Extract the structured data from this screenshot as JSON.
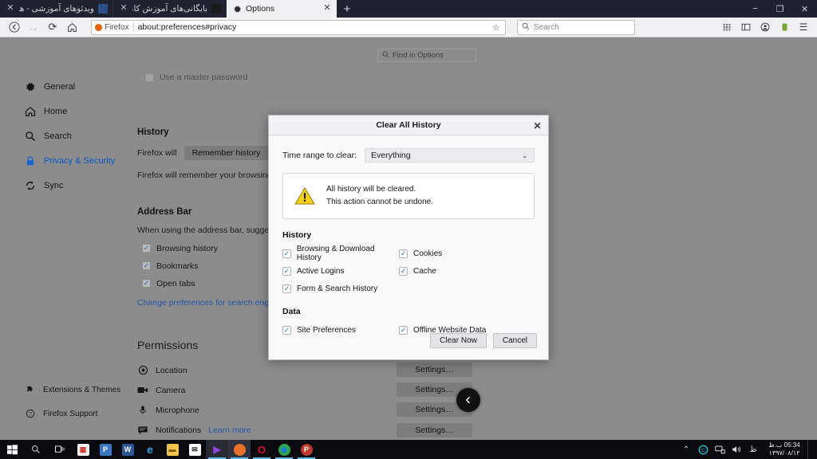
{
  "browser": {
    "tabs": [
      {
        "title": "ویدئوهای آموزشی - هوشیار",
        "favicon": "video-site-favicon",
        "active": false,
        "close_label": "✕"
      },
      {
        "title": "بایگانی‌های آموزش کامپیوتر - هو",
        "favicon": "archive-site-favicon",
        "active": false,
        "close_label": "✕"
      },
      {
        "title": "Options",
        "favicon": "gear-icon",
        "active": true,
        "close_label": "✕"
      }
    ],
    "new_tab_label": "+",
    "window_controls": {
      "minimize": "−",
      "maximize": "❐",
      "close": "✕"
    },
    "nav": {
      "back": "←",
      "forward": "→",
      "reload": "⟳",
      "home": "⌂",
      "identity_label": "Firefox",
      "url": "about:preferences#privacy",
      "bookmark_star": "☆",
      "search_placeholder": "Search",
      "search_icon": "search-icon"
    },
    "toolbar_icons": [
      {
        "name": "library-icon",
        "glyph": "𝍖"
      },
      {
        "name": "sidebar-icon",
        "glyph": "▯"
      },
      {
        "name": "account-icon",
        "glyph": "☻"
      },
      {
        "name": "container-icon",
        "glyph": "▮"
      },
      {
        "name": "menu-icon",
        "glyph": "☰"
      }
    ]
  },
  "preferences": {
    "find_placeholder": "Find in Options",
    "find_icon": "search-icon",
    "sidebar": [
      {
        "label": "General",
        "icon": "gear-icon",
        "active": false
      },
      {
        "label": "Home",
        "icon": "home-icon",
        "active": false
      },
      {
        "label": "Search",
        "icon": "search-icon",
        "active": false
      },
      {
        "label": "Privacy & Security",
        "icon": "lock-icon",
        "active": true
      },
      {
        "label": "Sync",
        "icon": "sync-icon",
        "active": false
      }
    ],
    "sidebar_bottom": [
      {
        "label": "Extensions & Themes",
        "icon": "puzzle-icon"
      },
      {
        "label": "Firefox Support",
        "icon": "question-icon"
      }
    ],
    "history": {
      "heading": "History",
      "will_label": "Firefox will",
      "mode": "Remember history",
      "description": "Firefox will remember your browsing, d"
    },
    "address_bar": {
      "heading": "Address Bar",
      "subtitle": "When using the address bar, suggest",
      "options": [
        {
          "label": "Browsing history",
          "checked": true
        },
        {
          "label": "Bookmarks",
          "checked": true
        },
        {
          "label": "Open tabs",
          "checked": true
        }
      ],
      "link": "Change preferences for search engine s"
    },
    "permissions": {
      "heading": "Permissions",
      "rows": [
        {
          "label": "Location",
          "icon": "location-icon",
          "button": "Settings…"
        },
        {
          "label": "Camera",
          "icon": "camera-icon",
          "button": "Settings…"
        },
        {
          "label": "Microphone",
          "icon": "microphone-icon",
          "button": "Settings…"
        },
        {
          "label": "Notifications",
          "icon": "notification-icon",
          "button": "Settings…",
          "link": "Learn more"
        }
      ]
    },
    "scroll_button_icon": "chevron-left-icon"
  },
  "dialog": {
    "title": "Clear All History",
    "close_label": "✕",
    "time_range_label": "Time range to clear:",
    "time_range_value": "Everything",
    "chevron": "⌄",
    "warning": {
      "icon": "warning-triangle-icon",
      "line1": "All history will be cleared.",
      "line2": "This action cannot be undone."
    },
    "history_heading": "History",
    "history_items": [
      {
        "label": "Browsing & Download History",
        "checked": true
      },
      {
        "label": "Cookies",
        "checked": true
      },
      {
        "label": "Active Logins",
        "checked": true
      },
      {
        "label": "Cache",
        "checked": true
      },
      {
        "label": "Form & Search History",
        "checked": true
      }
    ],
    "data_heading": "Data",
    "data_items": [
      {
        "label": "Site Preferences",
        "checked": true
      },
      {
        "label": "Offline Website Data",
        "checked": true
      }
    ],
    "clear_button": "Clear Now",
    "cancel_button": "Cancel",
    "check_glyph": "✓"
  },
  "taskbar": {
    "start_icon": "windows-start-icon",
    "search_icon": "search-icon",
    "taskview_icon": "task-view-icon",
    "apps": [
      {
        "name": "microsoft-store-icon",
        "glyph": "▤",
        "color": "#f0f0f0",
        "text": "#d14",
        "running": false
      },
      {
        "name": "powerpoint-icon",
        "glyph": "P",
        "color": "#2f6fb8",
        "text": "#ffffff",
        "running": false
      },
      {
        "name": "word-icon",
        "glyph": "W",
        "color": "#2b579a",
        "text": "#ffffff",
        "running": false
      },
      {
        "name": "edge-icon",
        "glyph": "e",
        "color": "#0b78d0",
        "text": "#ffffff",
        "running": false
      },
      {
        "name": "file-explorer-icon",
        "glyph": "▭",
        "color": "#f5c34a",
        "text": "#7a5a0a",
        "running": false
      },
      {
        "name": "mail-icon",
        "glyph": "✉",
        "color": "#ffffff",
        "text": "#333333",
        "running": false
      },
      {
        "name": "media-player-icon",
        "glyph": "▶",
        "color": "#7b3fd4",
        "text": "#ffffff",
        "running": true
      },
      {
        "name": "firefox-icon",
        "glyph": "🦊",
        "color": "#e8732b",
        "text": "#ffffff",
        "running": true
      },
      {
        "name": "opera-icon",
        "glyph": "O",
        "color": "#d8102a",
        "text": "#ffffff",
        "running": true
      },
      {
        "name": "chrome-icon",
        "glyph": "◉",
        "color": "#3aa757",
        "text": "#ffffff",
        "running": true
      },
      {
        "name": "potplayer-icon",
        "glyph": "P",
        "color": "#c0392b",
        "text": "#ffffff",
        "running": true
      }
    ],
    "tray": [
      {
        "name": "show-hidden-icons",
        "glyph": "⌃"
      },
      {
        "name": "antivirus-icon",
        "glyph": "C"
      },
      {
        "name": "network-icon",
        "glyph": "🖧"
      },
      {
        "name": "volume-icon",
        "glyph": "🔊"
      },
      {
        "name": "input-language-icon",
        "glyph": "ظ"
      }
    ],
    "clock_time": "05:34 ب.ظ",
    "clock_date": "۱۳۹۷/۰۸/۱۲",
    "show_desktop": "show-desktop-button"
  },
  "colors": {
    "tabbar_bg": "#20232f",
    "accent_blue": "#0a57c2",
    "check_blue": "#2a78d4",
    "warning_yellow": "#f5c518",
    "firefox_orange": "#e66000"
  }
}
